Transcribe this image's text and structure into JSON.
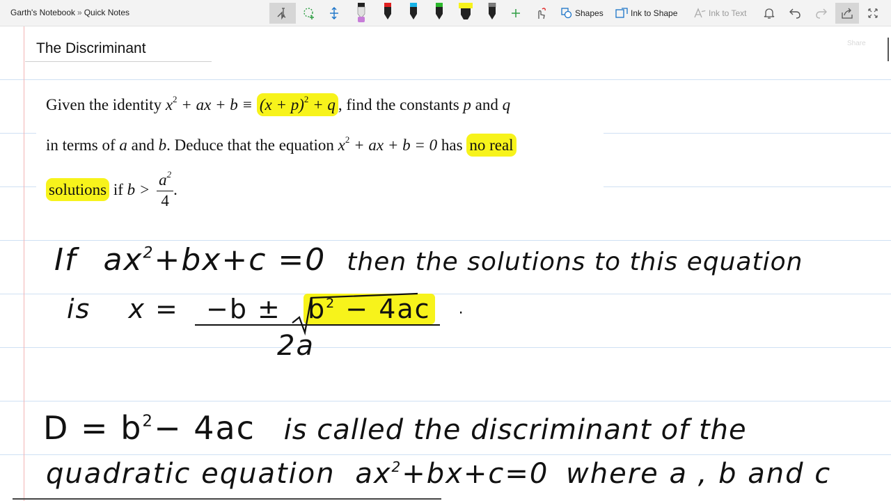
{
  "breadcrumb": {
    "notebook": "Garth's Notebook",
    "separator": "»",
    "section": "Quick Notes"
  },
  "toolbar": {
    "shapes_label": "Shapes",
    "ink_to_shape_label": "Ink to Shape",
    "ink_to_text_label": "Ink to Text",
    "pens": [
      {
        "name": "pen-black",
        "color": "#111111"
      },
      {
        "name": "pen-red",
        "color": "#e02020"
      },
      {
        "name": "pen-cyan",
        "color": "#19b4e8"
      },
      {
        "name": "pen-green",
        "color": "#2db82d"
      },
      {
        "name": "highlighter-yellow",
        "color": "#f7f31b"
      },
      {
        "name": "pen-gray",
        "color": "#7d7d7d"
      }
    ]
  },
  "page": {
    "title": "The Discriminant",
    "share_ghost": "Share"
  },
  "question": {
    "l1_a": "Given the identity",
    "l1_math_a": "x",
    "l1_math_b": "+ ax + b ≡",
    "l1_hl": "(x + p)",
    "l1_hl_tail": "+ q",
    "l1_b": ", find the constants",
    "l1_p": "p",
    "l1_c": "and",
    "l1_q": "q",
    "l2_a": "in terms of",
    "l2_av": "a",
    "l2_b": "and",
    "l2_bv": "b",
    "l2_c": ". Deduce that the equation",
    "l2_math": "+ ax + b = 0",
    "l2_d": "has",
    "l2_hl": "no real",
    "l3_hl": "solutions",
    "l3_a": "if",
    "l3_b": "b >",
    "l3_num": "a",
    "l3_den": "4",
    "l3_end": ".",
    "sup2": "2"
  },
  "handwriting": {
    "line1_a": "If",
    "line1_b": "ax",
    "line1_c": "+bx+c =0",
    "line1_d": "then the solutions to this equation",
    "line2_a": "is",
    "line2_b": "x  =",
    "line2_c": "−b ±",
    "line2_hl": "b",
    "line2_hl_tail": "− 4ac",
    "line2_dot": "·",
    "line3": "2a",
    "line4_a": "D = b",
    "line4_b": "− 4ac",
    "line4_c": "is called the discriminant of the",
    "line5_a": "quadratic equation",
    "line5_b": "ax",
    "line5_c": "+bx+c=0",
    "line5_d": "where a , b and c",
    "sup2": "2"
  }
}
